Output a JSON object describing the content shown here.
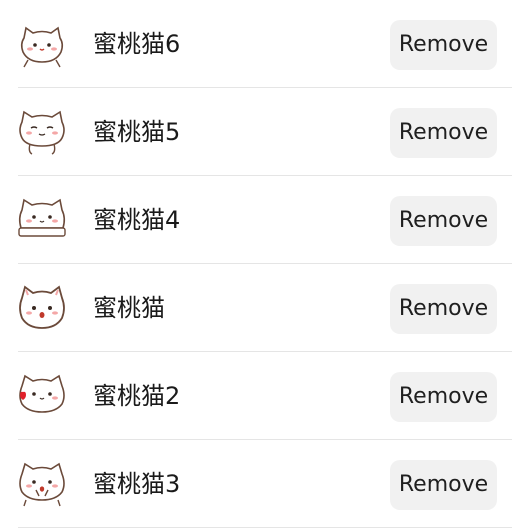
{
  "stickers": [
    {
      "name": "蜜桃猫6",
      "icon": "peach-cat-icon",
      "remove_label": "Remove"
    },
    {
      "name": "蜜桃猫5",
      "icon": "peach-cat-icon",
      "remove_label": "Remove"
    },
    {
      "name": "蜜桃猫4",
      "icon": "peach-cat-icon",
      "remove_label": "Remove"
    },
    {
      "name": "蜜桃猫",
      "icon": "peach-cat-icon",
      "remove_label": "Remove"
    },
    {
      "name": "蜜桃猫2",
      "icon": "peach-cat-icon",
      "remove_label": "Remove"
    },
    {
      "name": "蜜桃猫3",
      "icon": "peach-cat-icon",
      "remove_label": "Remove"
    }
  ],
  "colors": {
    "button_bg": "#f1f1f1",
    "divider": "#e5e5e5",
    "cat_outline": "#6b4a3a",
    "cat_blush": "#f4a7a7",
    "heart": "#e0202a"
  }
}
